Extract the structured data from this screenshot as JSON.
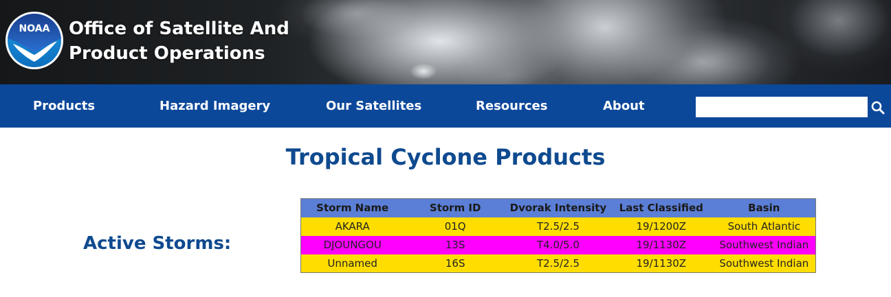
{
  "header": {
    "logo_text": "NOAA",
    "title_line1": "Office of Satellite And",
    "title_line2": "Product Operations"
  },
  "nav": {
    "items": [
      {
        "label": "Products"
      },
      {
        "label": "Hazard Imagery"
      },
      {
        "label": "Our Satellites"
      },
      {
        "label": "Resources"
      },
      {
        "label": "About"
      }
    ],
    "search": {
      "value": "",
      "placeholder": ""
    }
  },
  "main": {
    "page_title": "Tropical Cyclone Products",
    "active_label": "Active Storms:",
    "table": {
      "columns": [
        "Storm Name",
        "Storm ID",
        "Dvorak Intensity",
        "Last Classified",
        "Basin"
      ],
      "rows": [
        {
          "cells": [
            "AKARA",
            "01Q",
            "T2.5/2.5",
            "19/1200Z",
            "South Atlantic"
          ],
          "color": "#ffdd00"
        },
        {
          "cells": [
            "DJOUNGOU",
            "13S",
            "T4.0/5.0",
            "19/1130Z",
            "Southwest Indian"
          ],
          "color": "#ff00ff"
        },
        {
          "cells": [
            "Unnamed",
            "16S",
            "T2.5/2.5",
            "19/1130Z",
            "Southwest Indian"
          ],
          "color": "#ffdd00"
        }
      ]
    }
  },
  "colors": {
    "nav_bg": "#0c489a",
    "title_blue": "#0f4a8f",
    "table_header_bg": "#5b7fd6"
  },
  "icons": {
    "logo": "noaa-logo",
    "search": "search-icon"
  }
}
